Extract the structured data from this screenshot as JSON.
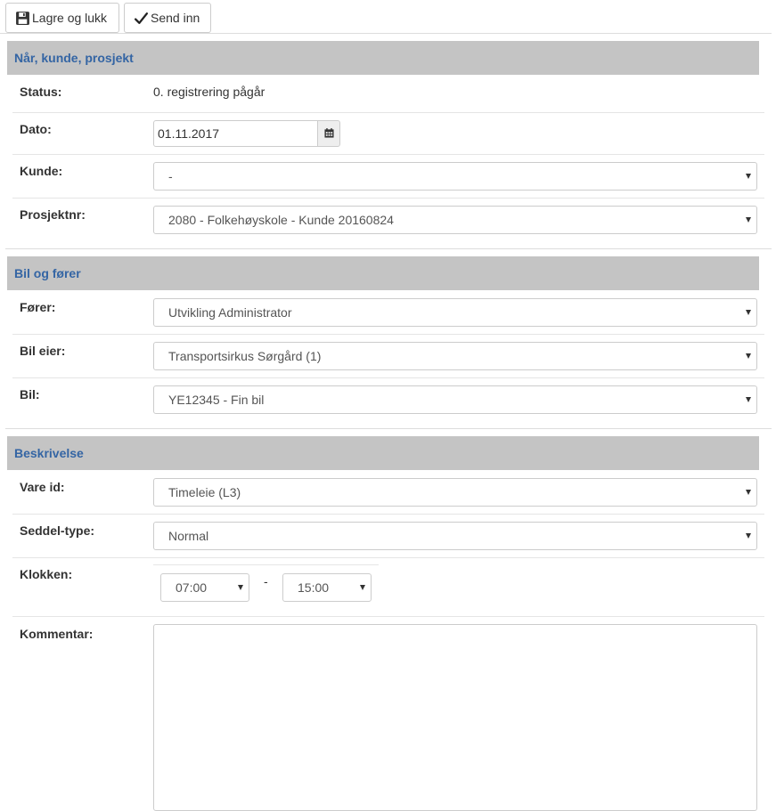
{
  "toolbar": {
    "save_label": "Lagre og lukk",
    "send_label": "Send inn",
    "save_icon": "floppy-disk-icon",
    "send_icon": "checkmark-icon"
  },
  "sections": {
    "customer": {
      "title": "Når, kunde, prosjekt"
    },
    "vehicle": {
      "title": "Bil og fører"
    },
    "description": {
      "title": "Beskrivelse"
    }
  },
  "fields": {
    "status": {
      "label": "Status:",
      "value": "0. registrering pågår"
    },
    "date": {
      "label": "Dato:",
      "value": "01.11.2017",
      "icon": "calendar-icon"
    },
    "customer": {
      "label": "Kunde:",
      "value": "-"
    },
    "project": {
      "label": "Prosjektnr:",
      "value": "2080 - Folkehøyskole - Kunde 20160824"
    },
    "driver": {
      "label": "Fører:",
      "value": "Utvikling Administrator"
    },
    "car_owner": {
      "label": "Bil eier:",
      "value": "Transportsirkus Sørgård (1)"
    },
    "car": {
      "label": "Bil:",
      "value": "YE12345 - Fin bil"
    },
    "item": {
      "label": "Vare id:",
      "value": "Timeleie (L3)"
    },
    "slip_type": {
      "label": "Seddel-type:",
      "value": "Normal"
    },
    "time": {
      "label": "Klokken:",
      "from": "07:00",
      "separator": "-",
      "to": "15:00"
    },
    "comment": {
      "label": "Kommentar:",
      "value": ""
    }
  }
}
